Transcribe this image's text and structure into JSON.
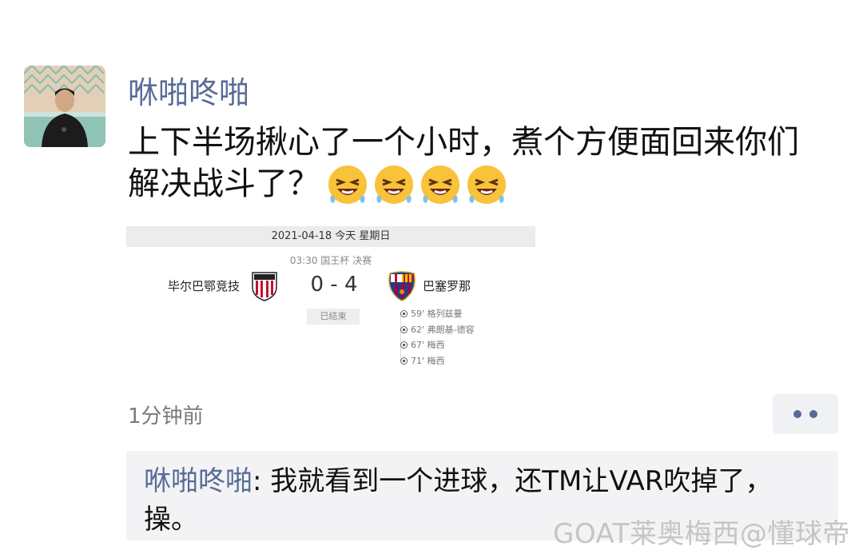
{
  "post": {
    "username": "咻啪咚啪",
    "text": "上下半场揪心了一个小时，煮个方便面回来你们解决战斗了？",
    "emoji": [
      "grinning-squint-drool-emoji",
      "grinning-squint-drool-emoji",
      "grinning-squint-drool-emoji",
      "grinning-squint-drool-emoji"
    ],
    "timestamp": "1分钟前"
  },
  "match_card": {
    "date_line": "2021-04-18 今天 星期日",
    "sub_line": "03:30 国王杯 决赛",
    "home_team": "毕尔巴鄂竞技",
    "away_team": "巴塞罗那",
    "score": "0 - 4",
    "status": "已结束",
    "goals": [
      {
        "text": "59' 格列兹曼"
      },
      {
        "text": "62' 弗朗基-德容"
      },
      {
        "text": "67' 梅西"
      },
      {
        "text": "71' 梅西"
      }
    ],
    "icons": {
      "home_badge": "athletic-bilbao-crest-icon",
      "away_badge": "barcelona-crest-icon",
      "goal": "soccer-ball-icon"
    }
  },
  "comment": {
    "user": "咻啪咚啪",
    "separator": ": ",
    "text": "我就看到一个进球，还TM让VAR吹掉了，操。"
  },
  "watermark": "GOAT莱奥梅西@懂球帝",
  "colors": {
    "link": "#576b95",
    "comment_bg": "#f3f3f5",
    "card_header_bg": "#ececec"
  }
}
